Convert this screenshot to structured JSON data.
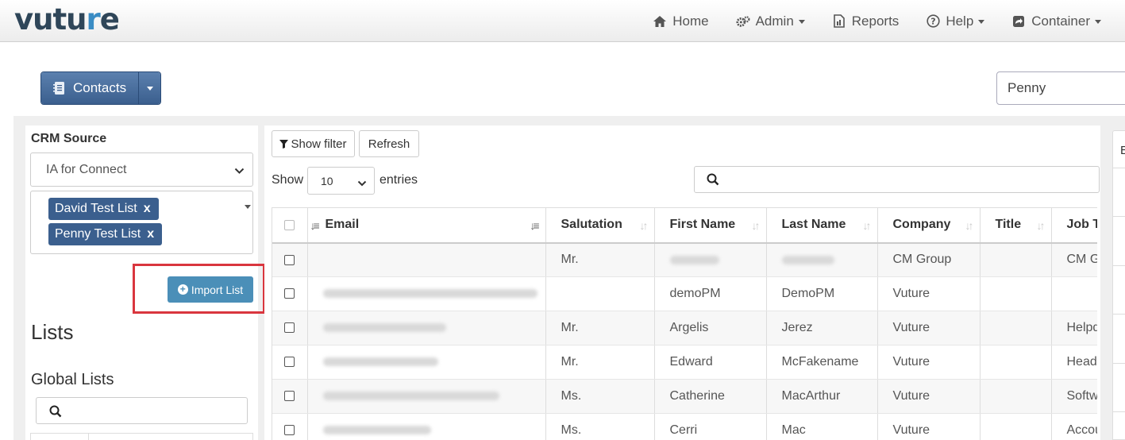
{
  "brand": {
    "logo_text_a": "vutu",
    "logo_text_b": "r",
    "logo_text_c": "e"
  },
  "nav": [
    {
      "label": "Home",
      "icon": "home-icon",
      "dropdown": false
    },
    {
      "label": "Admin",
      "icon": "gears-icon",
      "dropdown": true
    },
    {
      "label": "Reports",
      "icon": "report-icon",
      "dropdown": false
    },
    {
      "label": "Help",
      "icon": "question-circle-icon",
      "dropdown": true
    },
    {
      "label": "Container",
      "icon": "share-square-icon",
      "dropdown": true
    }
  ],
  "contacts_button": {
    "label": "Contacts",
    "icon": "address-book-icon"
  },
  "top_search": {
    "value": "Penny"
  },
  "left": {
    "crm_label": "CRM Source",
    "crm_value": "IA for Connect",
    "tags": [
      {
        "label": "David Test List",
        "remove": "x"
      },
      {
        "label": "Penny Test List",
        "remove": "x"
      }
    ],
    "import_button": "Import List",
    "lists_title": "Lists",
    "global_lists_title": "Global Lists"
  },
  "toolbar": {
    "show_filter": "Show filter",
    "refresh": "Refresh",
    "show": "Show",
    "entries_value": "10",
    "entries": "entries"
  },
  "table": {
    "columns": [
      "Email",
      "Salutation",
      "First Name",
      "Last Name",
      "Company",
      "Title",
      "Job Title"
    ],
    "rows": [
      {
        "email_redacted": true,
        "salutation": "Mr.",
        "first_name": "",
        "last_name": "",
        "company": "CM Group",
        "title": "",
        "job_title": "CM G"
      },
      {
        "email_redacted": true,
        "salutation": "",
        "first_name": "demoPM",
        "last_name": "DemoPM",
        "company": "Vuture",
        "title": "",
        "job_title": ""
      },
      {
        "email_redacted": true,
        "salutation": "Mr.",
        "first_name": "Argelis",
        "last_name": "Jerez",
        "company": "Vuture",
        "title": "",
        "job_title": "Helpd"
      },
      {
        "email_redacted": true,
        "salutation": "Mr.",
        "first_name": "Edward",
        "last_name": "McFakename",
        "company": "Vuture",
        "title": "",
        "job_title": "Head"
      },
      {
        "email_redacted": true,
        "salutation": "Ms.",
        "first_name": "Catherine",
        "last_name": "MacArthur",
        "company": "Vuture",
        "title": "",
        "job_title": "Softw"
      },
      {
        "email_redacted": true,
        "salutation": "Ms.",
        "first_name": "Cerri",
        "last_name": "Mac",
        "company": "Vuture",
        "title": "",
        "job_title": "Accou"
      }
    ]
  },
  "right_panel": {
    "partial_char": "E"
  },
  "colors": {
    "primary": "#3b5f8e",
    "import": "#4b8fb8",
    "highlight": "#d9363e",
    "logo": "#2f4659"
  }
}
